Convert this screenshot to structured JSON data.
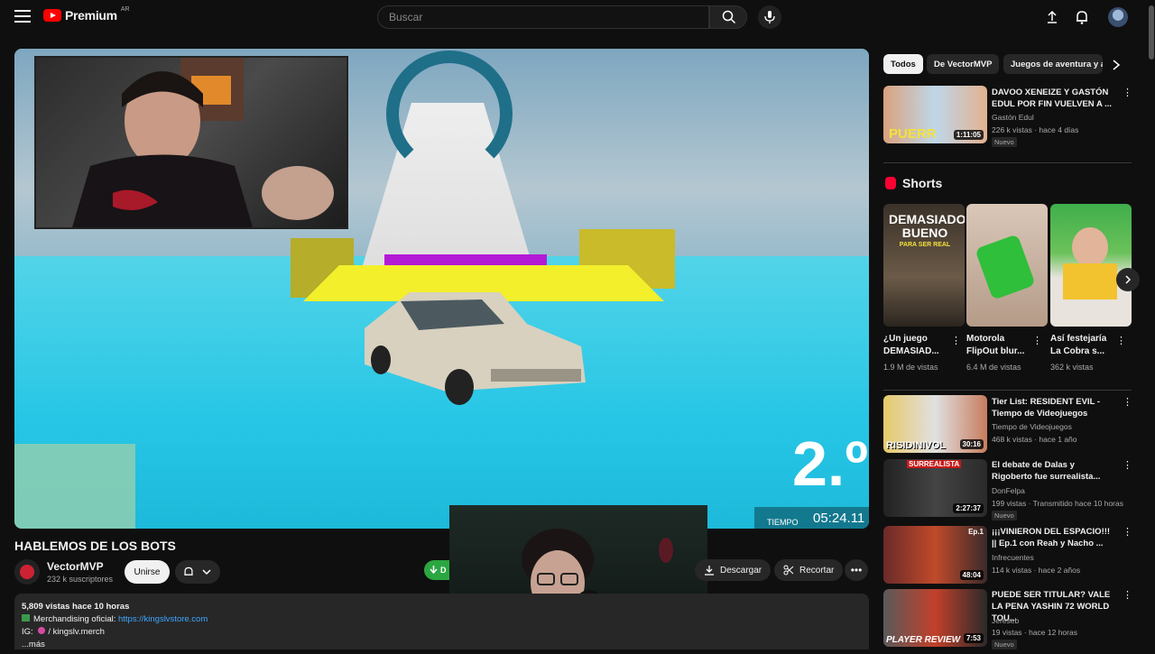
{
  "header": {
    "logo_text": "Premium",
    "country": "AR",
    "search_placeholder": "Buscar"
  },
  "player": {
    "race_position": "2.º",
    "time_label": "TIEMPO",
    "time_value": "05:24.11"
  },
  "video": {
    "title": "HABLEMOS DE LOS BOTS",
    "channel": "VectorMVP",
    "subscribers": "232 k suscriptores",
    "join_label": "Unirse",
    "green_label": "D",
    "download_label": "Descargar",
    "clip_label": "Recortar",
    "more_label": "•••"
  },
  "description": {
    "stats": "5,809 vistas  hace 10 horas",
    "line1_label": "Merchandising oficial:",
    "line1_link": "https://kingslvstore.com",
    "line2_label": "IG:",
    "line2_value": "/ kingslv.merch",
    "more": "...más"
  },
  "chips": [
    "Todos",
    "De VectorMVP",
    "Juegos de aventura y a"
  ],
  "shelf_title": "Shorts",
  "recommendations": [
    {
      "title": "DAVOO XENEIZE Y GASTÓN EDUL POR FIN VUELVEN A ...",
      "channel": "Gastón Edul",
      "meta": "226 k vistas · hace 4 días",
      "badge": "Nuevo",
      "duration": "1:11:05",
      "thumb_text": "PUERR"
    },
    {
      "title": "Tier List: RESIDENT EVIL - Tiempo de Videojuegos",
      "channel": "Tiempo de Videojuegos",
      "meta": "468 k vistas · hace 1 año",
      "badge": "",
      "duration": "30:16",
      "thumb_text": "RISIDINIVOL"
    },
    {
      "title": "El debate de Dalas y Rigoberto fue surrealista...",
      "channel": "DonFelpa",
      "meta": "199 vistas · Transmitido hace 10 horas",
      "badge": "Nuevo",
      "duration": "2:27:37",
      "thumb_text": "SURREALISTA"
    },
    {
      "title": "¡¡¡VINIERON DEL ESPACIO!!! || Ep.1 con Reah y Nacho ...",
      "channel": "Infrecuentes",
      "meta": "114 k vistas · hace 2 años",
      "badge": "",
      "duration": "48:04",
      "thumb_text": "Ep.1"
    },
    {
      "title": "PUEDE SER TITULAR? VALE LA PENA YASHIN 72 WORLD TOU...",
      "channel": "Jereseb",
      "meta": "19 vistas · hace 12 horas",
      "badge": "Nuevo",
      "duration": "7:53",
      "thumb_text": "PLAYER REVIEW"
    }
  ],
  "shorts": [
    {
      "title": "¿Un juego DEMASIAD...",
      "views": "1.9 M de vistas",
      "thumb_text": "DEMASIADO BUENO",
      "thumb_sub": "PARA SER REAL"
    },
    {
      "title": "Motorola FlipOut blur...",
      "views": "6.4 M de vistas",
      "thumb_text": "",
      "thumb_sub": ""
    },
    {
      "title": "Así festejaría La Cobra s...",
      "views": "362 k vistas",
      "thumb_text": "",
      "thumb_sub": ""
    }
  ],
  "colors": {
    "background": "#0f0f0f",
    "accent_red": "#ff0000",
    "link": "#3ea6ff",
    "green_button": "#2ba640"
  }
}
